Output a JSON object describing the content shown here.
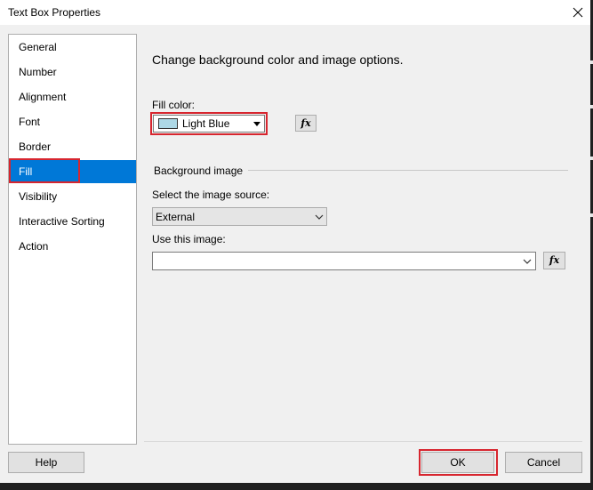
{
  "window": {
    "title": "Text Box Properties"
  },
  "nav": {
    "items": [
      {
        "label": "General"
      },
      {
        "label": "Number"
      },
      {
        "label": "Alignment"
      },
      {
        "label": "Font"
      },
      {
        "label": "Border"
      },
      {
        "label": "Fill"
      },
      {
        "label": "Visibility"
      },
      {
        "label": "Interactive Sorting"
      },
      {
        "label": "Action"
      }
    ],
    "selected": "Fill"
  },
  "fill": {
    "heading": "Change background color and image options.",
    "fill_color_label": "Fill color:",
    "fill_color_value": "Light Blue",
    "fill_color_swatch": "#add8e6",
    "fx_label": "fx",
    "background_image_group": "Background image",
    "image_source_label": "Select the image source:",
    "image_source_value": "External",
    "use_image_label": "Use this image:",
    "use_image_value": ""
  },
  "buttons": {
    "help": "Help",
    "ok": "OK",
    "cancel": "Cancel"
  },
  "colors": {
    "selection": "#0078d7",
    "highlight": "#d7262f"
  }
}
